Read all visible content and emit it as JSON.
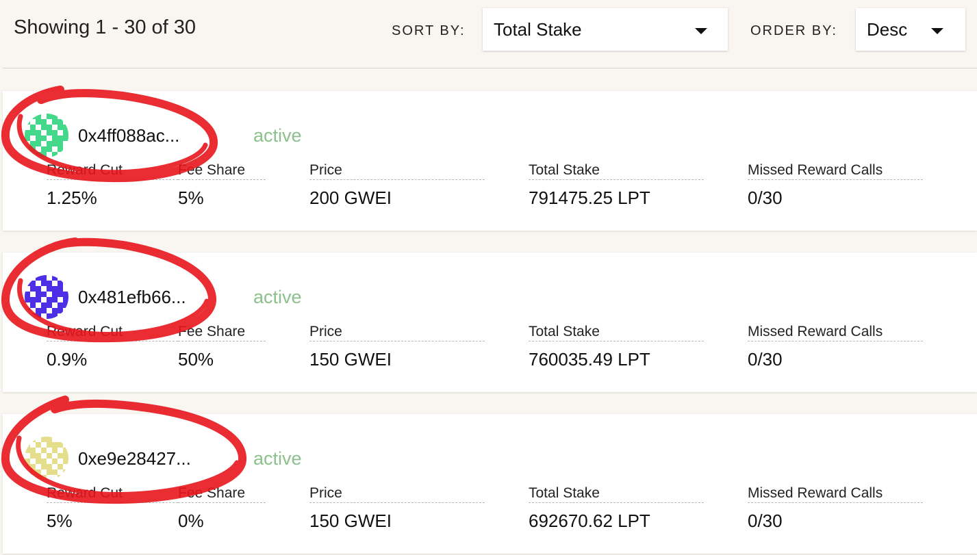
{
  "header": {
    "showing_text": "Showing 1 - 30 of 30",
    "sort_label": "SORT BY:",
    "sort_value": "Total Stake",
    "order_label": "ORDER BY:",
    "order_value": "Desc"
  },
  "colors": {
    "active": "#8cc08c",
    "annotation": "#e8161d"
  },
  "transcoders": [
    {
      "address": "0x4ff088ac...",
      "status": "active",
      "avatar_color": "#44d98a",
      "labels": [
        "Reward Cut",
        "Fee Share",
        "Price",
        "Total Stake",
        "Missed Reward Calls"
      ],
      "values": [
        "1.25%",
        "5%",
        "200 GWEI",
        "791475.25 LPT",
        "0/30"
      ]
    },
    {
      "address": "0x481efb66...",
      "status": "active",
      "avatar_color": "#4e2fe6",
      "labels": [
        "Reward Cut",
        "Fee Share",
        "Price",
        "Total Stake",
        "Missed Reward Calls"
      ],
      "values": [
        "0.9%",
        "50%",
        "150 GWEI",
        "760035.49 LPT",
        "0/30"
      ]
    },
    {
      "address": "0xe9e28427...",
      "status": "active",
      "avatar_color": "#e3dd8c",
      "labels": [
        "Reward Cut",
        "Fee Share",
        "Price",
        "Total Stake",
        "Missed Reward Calls"
      ],
      "values": [
        "5%",
        "0%",
        "150 GWEI",
        "692670.62 LPT",
        "0/30"
      ]
    }
  ]
}
